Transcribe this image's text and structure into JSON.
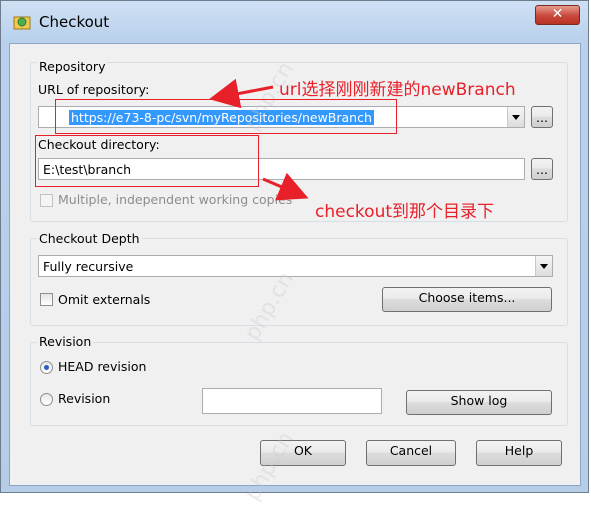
{
  "window": {
    "title": "Checkout",
    "close_label": "✕"
  },
  "repository": {
    "group_label": "Repository",
    "url_label": "URL of repository:",
    "url_value": "https://e73-8-pc/svn/myRepositories/newBranch",
    "checkout_dir_label": "Checkout directory:",
    "checkout_dir_value": "E:\\test\\branch",
    "browse_label": "...",
    "multiple_label": "Multiple, independent working copies"
  },
  "depth": {
    "group_label": "Checkout Depth",
    "selected": "Fully recursive",
    "omit_externals_label": "Omit externals",
    "choose_items_label": "Choose items..."
  },
  "revision": {
    "group_label": "Revision",
    "head_label": "HEAD revision",
    "revision_label": "Revision",
    "revision_value": "",
    "show_log_label": "Show log"
  },
  "footer": {
    "ok_label": "OK",
    "cancel_label": "Cancel",
    "help_label": "Help"
  },
  "annotations": {
    "url_note": "url选择刚刚新建的newBranch",
    "checkout_note": "checkout到那个目录下"
  },
  "watermark": "php.cn",
  "colors": {
    "annotation": "#e8202a",
    "selection": "#3399ff"
  }
}
